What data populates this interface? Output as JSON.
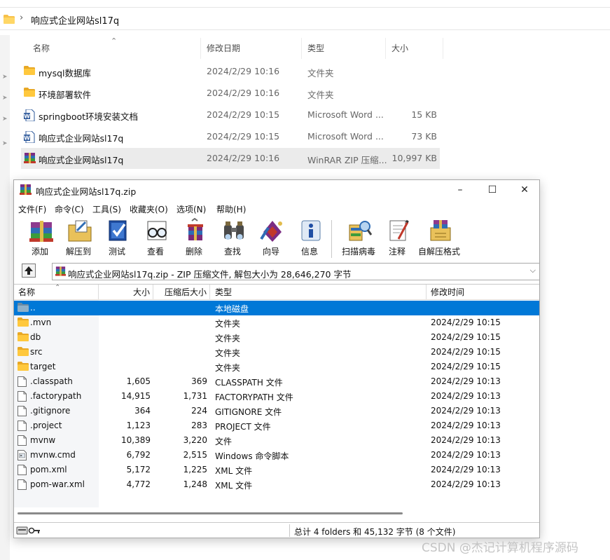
{
  "explorer": {
    "breadcrumb": "响应式企业网站sl17q",
    "columns": {
      "name": "名称",
      "date": "修改日期",
      "type": "类型",
      "size": "大小"
    },
    "rows": [
      {
        "name": "mysql数据库",
        "date": "2024/2/29 10:16",
        "type": "文件夹",
        "size": "",
        "icon": "folder-icon"
      },
      {
        "name": "环境部署软件",
        "date": "2024/2/29 10:16",
        "type": "文件夹",
        "size": "",
        "icon": "folder-icon"
      },
      {
        "name": "springboot环境安装文档",
        "date": "2024/2/29 10:15",
        "type": "Microsoft Word ...",
        "size": "15 KB",
        "icon": "word-doc-icon"
      },
      {
        "name": "响应式企业网站sl17q",
        "date": "2024/2/29 10:15",
        "type": "Microsoft Word ...",
        "size": "73 KB",
        "icon": "word-doc-icon"
      },
      {
        "name": "响应式企业网站sl17q",
        "date": "2024/2/29 10:16",
        "type": "WinRAR ZIP 压缩...",
        "size": "10,997 KB",
        "icon": "winrar-archive-icon",
        "selected": true
      }
    ]
  },
  "winrar": {
    "title": "响应式企业网站sl17q.zip",
    "window_buttons": {
      "minimize": "–",
      "maximize": "☐",
      "close": "✕"
    },
    "menu": [
      "文件(F)",
      "命令(C)",
      "工具(S)",
      "收藏夹(O)",
      "选项(N)",
      "帮助(H)"
    ],
    "toolbar": [
      {
        "label": "添加",
        "icon": "add-books-icon"
      },
      {
        "label": "解压到",
        "icon": "extract-to-icon"
      },
      {
        "label": "测试",
        "icon": "test-icon"
      },
      {
        "label": "查看",
        "icon": "view-glasses-icon"
      },
      {
        "label": "删除",
        "icon": "delete-icon"
      },
      {
        "label": "查找",
        "icon": "find-binoculars-icon"
      },
      {
        "label": "向导",
        "icon": "wizard-icon"
      },
      {
        "label": "信息",
        "icon": "info-icon"
      },
      {
        "label": "扫描病毒",
        "icon": "virus-scan-icon"
      },
      {
        "label": "注释",
        "icon": "comment-icon"
      },
      {
        "label": "自解压格式",
        "icon": "sfx-icon"
      }
    ],
    "path_text": "响应式企业网站sl17q.zip - ZIP 压缩文件, 解包大小为 28,646,270 字节",
    "columns": {
      "name": "名称",
      "size": "大小",
      "packed": "压缩后大小",
      "type": "类型",
      "modified": "修改时间"
    },
    "files": [
      {
        "name": "..",
        "size": "",
        "packed": "",
        "type": "本地磁盘",
        "modified": "",
        "icon": "parent-folder-icon",
        "selected": true
      },
      {
        "name": ".mvn",
        "size": "",
        "packed": "",
        "type": "文件夹",
        "modified": "2024/2/29 10:15",
        "icon": "folder-icon"
      },
      {
        "name": "db",
        "size": "",
        "packed": "",
        "type": "文件夹",
        "modified": "2024/2/29 10:15",
        "icon": "folder-icon"
      },
      {
        "name": "src",
        "size": "",
        "packed": "",
        "type": "文件夹",
        "modified": "2024/2/29 10:15",
        "icon": "folder-icon"
      },
      {
        "name": "target",
        "size": "",
        "packed": "",
        "type": "文件夹",
        "modified": "2024/2/29 10:15",
        "icon": "folder-icon"
      },
      {
        "name": ".classpath",
        "size": "1,605",
        "packed": "369",
        "type": "CLASSPATH 文件",
        "modified": "2024/2/29 10:13",
        "icon": "file-icon"
      },
      {
        "name": ".factorypath",
        "size": "14,915",
        "packed": "1,731",
        "type": "FACTORYPATH 文件",
        "modified": "2024/2/29 10:13",
        "icon": "file-icon"
      },
      {
        "name": ".gitignore",
        "size": "364",
        "packed": "224",
        "type": "GITIGNORE 文件",
        "modified": "2024/2/29 10:13",
        "icon": "file-icon"
      },
      {
        "name": ".project",
        "size": "1,123",
        "packed": "283",
        "type": "PROJECT 文件",
        "modified": "2024/2/29 10:13",
        "icon": "file-icon"
      },
      {
        "name": "mvnw",
        "size": "10,389",
        "packed": "3,220",
        "type": "文件",
        "modified": "2024/2/29 10:13",
        "icon": "file-icon"
      },
      {
        "name": "mvnw.cmd",
        "size": "6,792",
        "packed": "2,515",
        "type": "Windows 命令脚本",
        "modified": "2024/2/29 10:13",
        "icon": "cmd-script-icon"
      },
      {
        "name": "pom.xml",
        "size": "5,172",
        "packed": "1,225",
        "type": "XML 文件",
        "modified": "2024/2/29 10:13",
        "icon": "file-icon"
      },
      {
        "name": "pom-war.xml",
        "size": "4,772",
        "packed": "1,248",
        "type": "XML 文件",
        "modified": "2024/2/29 10:13",
        "icon": "file-icon"
      }
    ],
    "status_text": "总计 4 folders 和 45,132 字节 (8 个文件)"
  },
  "watermark": "CSDN @杰记计算机程序源码",
  "colors": {
    "selection": "#0078d7",
    "folder": "#f7c14a",
    "explorer_selected": "#ebebeb"
  }
}
